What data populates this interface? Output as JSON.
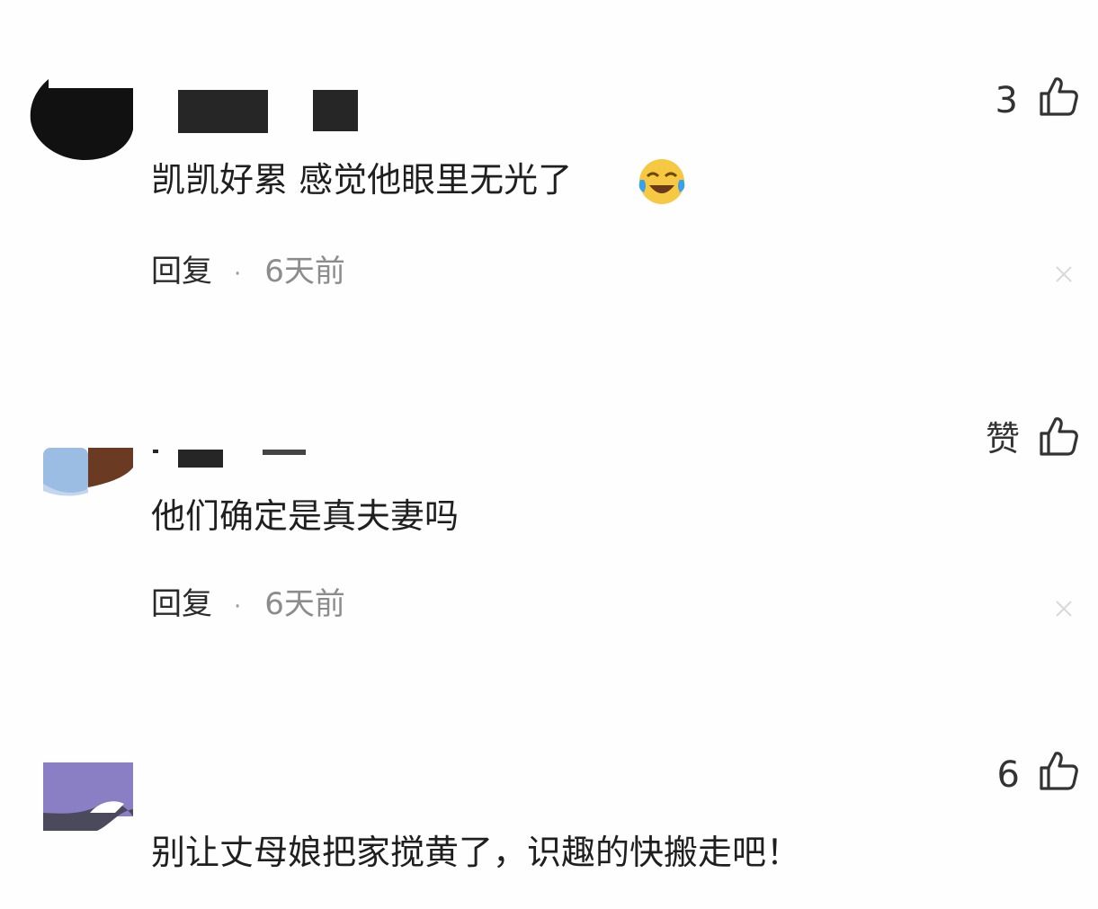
{
  "comments": [
    {
      "text": "凯凯好累 感觉他眼里无光了",
      "emoji": "crying-laughing-emoji",
      "reply_label": "回复",
      "separator": "·",
      "time": "6天前",
      "likes": "3"
    },
    {
      "text": "他们确定是真夫妻吗",
      "reply_label": "回复",
      "separator": "·",
      "time": "6天前",
      "likes": "赞"
    },
    {
      "text": "别让丈母娘把家搅黄了，识趣的快搬走吧！",
      "likes": "6"
    }
  ],
  "icons": {
    "like": "thumbs-up-icon",
    "dismiss": "close-icon"
  },
  "colors": {
    "text": "#1f1f1f",
    "meta": "#8c8c8c",
    "redaction": "#262626"
  }
}
